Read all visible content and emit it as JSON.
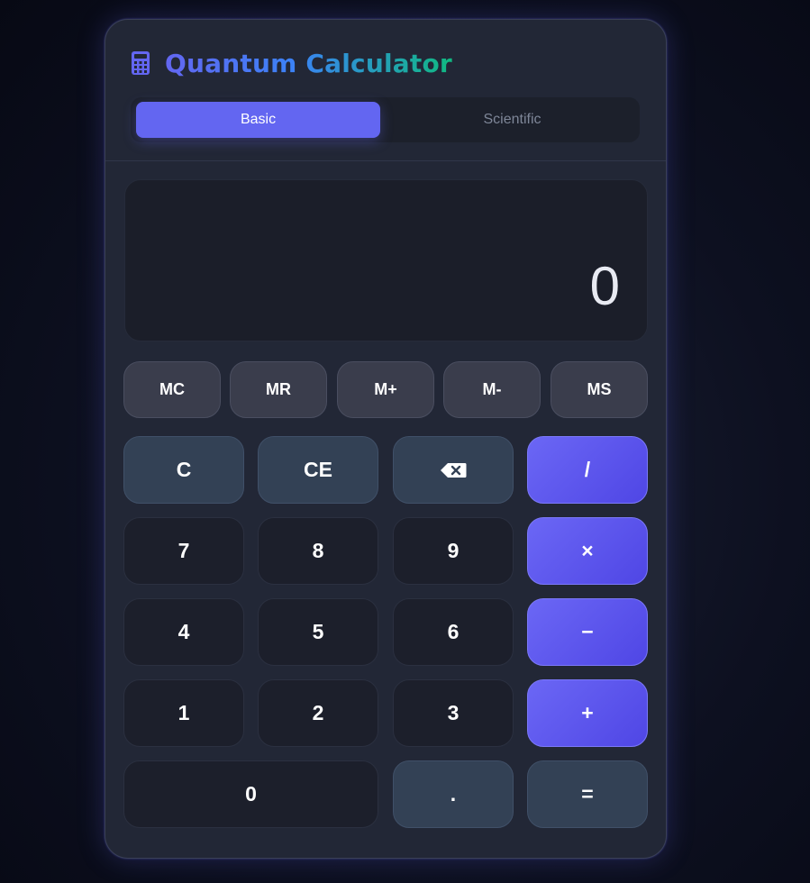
{
  "app": {
    "title": "Quantum Calculator",
    "icon": "calculator-icon"
  },
  "tabs": [
    {
      "label": "Basic",
      "active": true
    },
    {
      "label": "Scientific",
      "active": false
    }
  ],
  "display": {
    "value": "0"
  },
  "memory": [
    "MC",
    "MR",
    "M+",
    "M-",
    "MS"
  ],
  "keys": {
    "clear": "C",
    "clear_entry": "CE",
    "backspace_icon": "backspace-icon",
    "divide": "/",
    "multiply": "×",
    "subtract": "−",
    "add": "+",
    "equals": "=",
    "decimal": ".",
    "d7": "7",
    "d8": "8",
    "d9": "9",
    "d4": "4",
    "d5": "5",
    "d6": "6",
    "d1": "1",
    "d2": "2",
    "d3": "3",
    "d0": "0"
  },
  "colors": {
    "accent": "#6366f1",
    "panel": "#222736",
    "function_key": "#334155",
    "number_key": "#1c1f2b",
    "memory_key": "#3a3d4c"
  }
}
